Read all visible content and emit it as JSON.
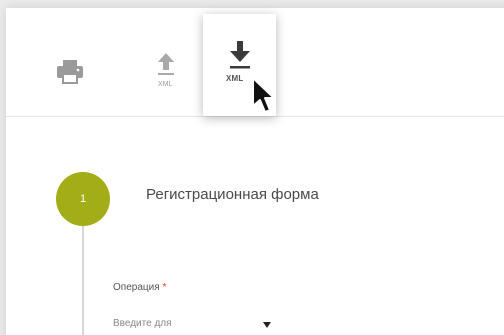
{
  "toolbar": {
    "print": {
      "icon": "printer-icon"
    },
    "upload": {
      "icon": "upload-icon",
      "label": "XML"
    },
    "download": {
      "icon": "download-icon",
      "label": "XML"
    }
  },
  "step": {
    "number": "1",
    "title": "Регистрационная форма"
  },
  "form": {
    "operation": {
      "label": "Операция",
      "required_mark": "*",
      "placeholder": "Введите для"
    }
  },
  "colors": {
    "accent": "#a3ad18",
    "required": "#e23a2e"
  }
}
